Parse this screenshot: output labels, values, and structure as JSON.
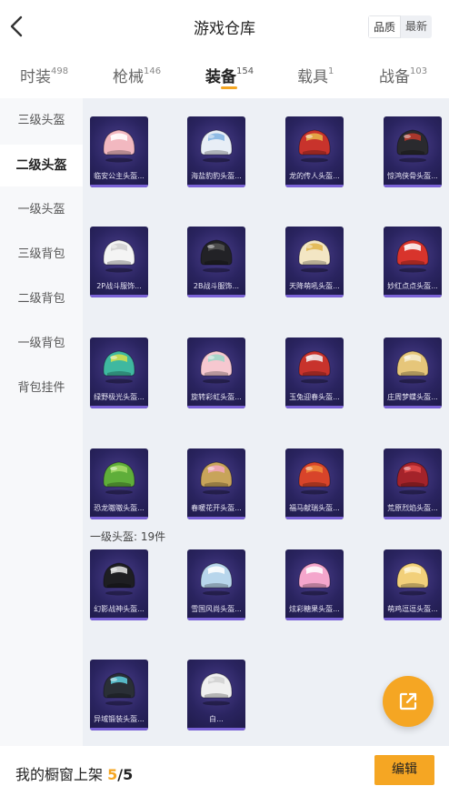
{
  "header": {
    "title": "游戏仓库",
    "sort_options": [
      {
        "label": "品质",
        "active": true
      },
      {
        "label": "最新",
        "active": false
      }
    ]
  },
  "tabs": [
    {
      "label": "时装",
      "count": "498",
      "active": false
    },
    {
      "label": "枪械",
      "count": "146",
      "active": false
    },
    {
      "label": "装备",
      "count": "154",
      "active": true
    },
    {
      "label": "载具",
      "count": "1",
      "active": false
    },
    {
      "label": "战备",
      "count": "103",
      "active": false
    }
  ],
  "sidebar": {
    "items": [
      {
        "label": "三级头盔",
        "active": false
      },
      {
        "label": "二级头盔",
        "active": true
      },
      {
        "label": "一级头盔",
        "active": false
      },
      {
        "label": "三级背包",
        "active": false
      },
      {
        "label": "二级背包",
        "active": false
      },
      {
        "label": "一级背包",
        "active": false
      },
      {
        "label": "背包挂件",
        "active": false
      }
    ]
  },
  "section": {
    "level1_label": "一级头盔: 19件"
  },
  "items": [
    {
      "label": "临安公主头盔...",
      "icon": "pink-dragon-helmet-icon",
      "main": "#f2b8c0",
      "accent": "#ffffff"
    },
    {
      "label": "海盐豹豹头盔...",
      "icon": "white-blue-helmet-icon",
      "main": "#e8eef6",
      "accent": "#7fb2e0"
    },
    {
      "label": "龙的传人头盔...",
      "icon": "red-gold-helmet-icon",
      "main": "#c8332c",
      "accent": "#e8b84a"
    },
    {
      "label": "惊鸿侠骨头盔...",
      "icon": "black-red-helmet-icon",
      "main": "#2a2a2e",
      "accent": "#c0392b"
    },
    {
      "label": "2P战斗服饰...",
      "icon": "white-military-helmet-icon",
      "main": "#f4f4f4",
      "accent": "#cfcfcf"
    },
    {
      "label": "2B战斗服饰...",
      "icon": "black-military-helmet-icon",
      "main": "#222226",
      "accent": "#555555"
    },
    {
      "label": "天降萌吼头盔...",
      "icon": "cream-yellow-helmet-icon",
      "main": "#f3e6c4",
      "accent": "#e0b44a"
    },
    {
      "label": "妙红点点头盔...",
      "icon": "red-white-helmet-icon",
      "main": "#d8342c",
      "accent": "#ffffff"
    },
    {
      "label": "绿野极光头盔...",
      "icon": "green-blue-helmet-icon",
      "main": "#3fb8a0",
      "accent": "#d8e04a"
    },
    {
      "label": "旋转彩虹头盔...",
      "icon": "pastel-rainbow-helmet-icon",
      "main": "#f6c8d0",
      "accent": "#9ad8c8"
    },
    {
      "label": "玉兔迎春头盔...",
      "icon": "red-white-rabbit-helmet-icon",
      "main": "#c8332c",
      "accent": "#f2f2f2"
    },
    {
      "label": "庄周梦蝶头盔...",
      "icon": "gold-butterfly-helmet-icon",
      "main": "#e6c67a",
      "accent": "#f6ecd0"
    },
    {
      "label": "恐龙嗷嗷头盔...",
      "icon": "green-dinosaur-helmet-icon",
      "main": "#5fae3a",
      "accent": "#a7dc6a"
    },
    {
      "label": "春暖花开头盔...",
      "icon": "gold-flower-helmet-icon",
      "main": "#c8a45a",
      "accent": "#f3a6c0"
    },
    {
      "label": "福马献瑞头盔...",
      "icon": "red-orange-helmet-icon",
      "main": "#d8442a",
      "accent": "#f08a3a"
    },
    {
      "label": "荒原烈焰头盔...",
      "icon": "dark-red-helmet-icon",
      "main": "#a4232a",
      "accent": "#e04a4a"
    },
    {
      "label": "幻影战神头盔...",
      "icon": "black-white-helmet-icon",
      "main": "#1e1e22",
      "accent": "#e8e8e8"
    },
    {
      "label": "雪国风尚头盔...",
      "icon": "light-blue-helmet-icon",
      "main": "#b8d6ec",
      "accent": "#ffffff"
    },
    {
      "label": "炫彩糖果头盔...",
      "icon": "pink-candy-helmet-icon",
      "main": "#f4a6cc",
      "accent": "#ffffff"
    },
    {
      "label": "萌鸡逗逗头盔...",
      "icon": "yellow-chick-helmet-icon",
      "main": "#f2d07a",
      "accent": "#fff2c8"
    },
    {
      "label": "异域锻装头盔...",
      "icon": "black-cyan-helmet-icon",
      "main": "#2a2f36",
      "accent": "#5fd0e0"
    },
    {
      "label": "白...",
      "icon": "white-helmet-icon",
      "main": "#f0f0f0",
      "accent": "#d0d0d0"
    }
  ],
  "fab": {
    "icon": "external-share-icon"
  },
  "bottom_bar": {
    "prefix": "我的橱窗上架 ",
    "current": "5",
    "total": "/5",
    "edit_label": "编辑"
  },
  "colors": {
    "accent": "#f5a623",
    "card_bg": "#2a2460",
    "card_stripe": "#7a62d6"
  }
}
